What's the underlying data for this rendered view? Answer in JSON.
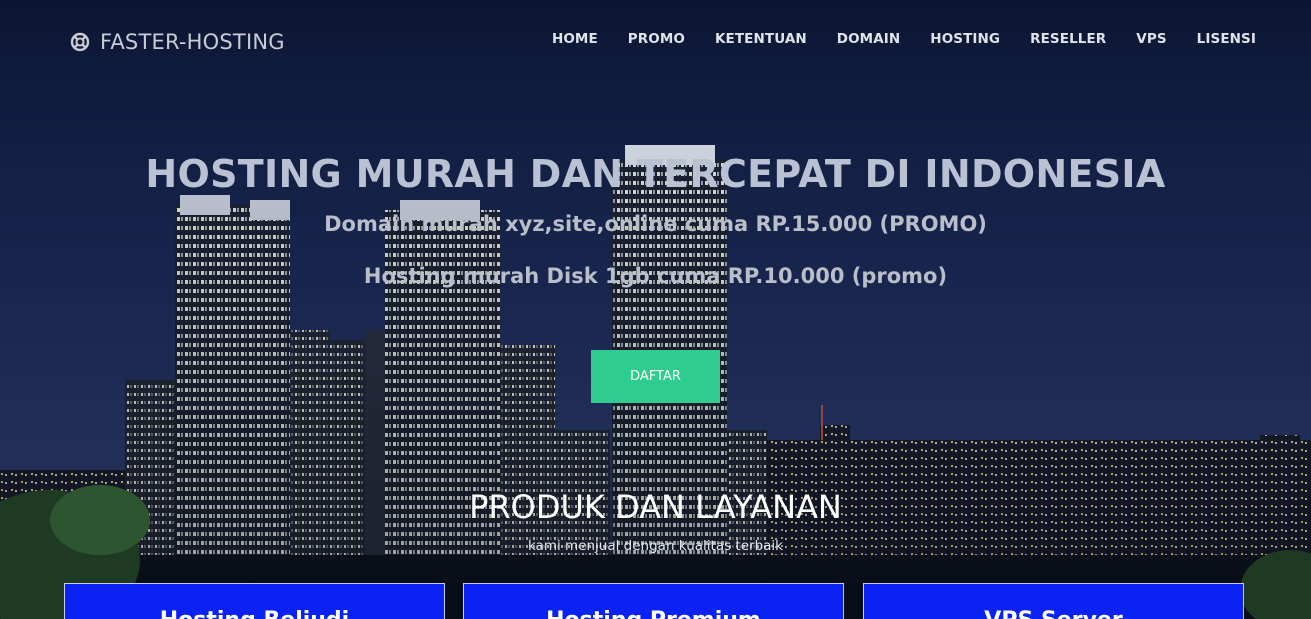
{
  "brand": {
    "name": "FASTER-HOSTING",
    "icon": "life-ring-icon"
  },
  "nav": {
    "items": [
      {
        "label": "HOME"
      },
      {
        "label": "PROMO"
      },
      {
        "label": "KETENTUAN"
      },
      {
        "label": "DOMAIN"
      },
      {
        "label": "HOSTING"
      },
      {
        "label": "RESELLER"
      },
      {
        "label": "VPS"
      },
      {
        "label": "LISENSI"
      }
    ]
  },
  "hero": {
    "title": "HOSTING MURAH DAN TERCEPAT DI INDONESIA",
    "line1": "Domain murah xyz,site,online cuma RP.15.000 (PROMO)",
    "line2": "Hosting murah Disk 1gb cuma RP.10.000 (promo)",
    "cta_label": "DAFTAR"
  },
  "products": {
    "title": "PRODUK DAN LAYANAN",
    "subtitle": "kami menjual dengan kualitas terbaik",
    "cards": [
      {
        "title": "Hosting Beliudi"
      },
      {
        "title": "Hosting Premium"
      },
      {
        "title": "VPS Server"
      }
    ]
  },
  "colors": {
    "accent": "#2ecc8f",
    "card_bg": "#0a23f2",
    "sky_top": "#0c1838",
    "sky_bottom": "#2a3f7a"
  }
}
